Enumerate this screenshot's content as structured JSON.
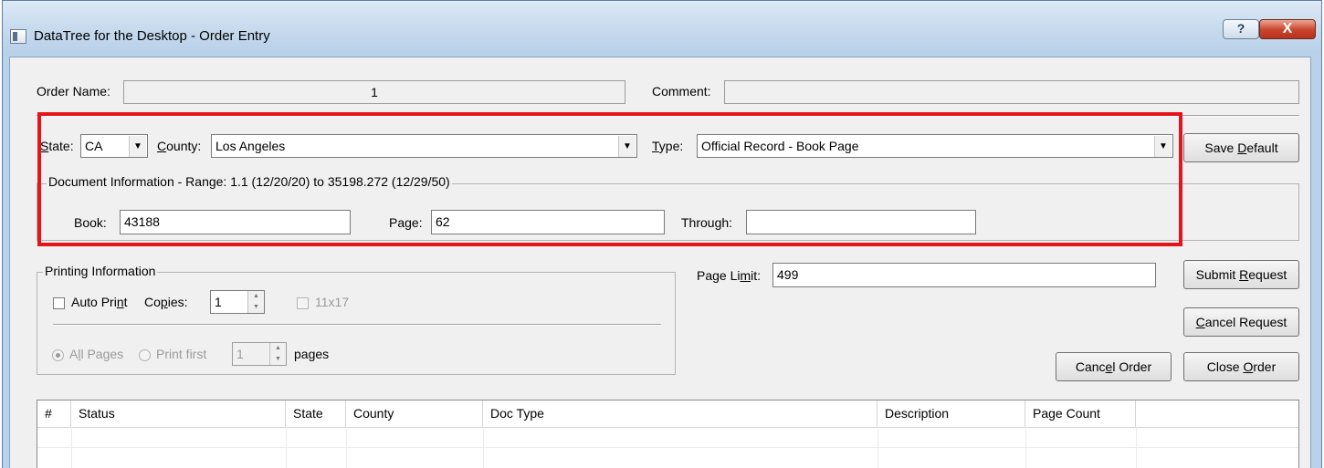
{
  "window": {
    "title": "DataTree for the Desktop - Order Entry",
    "help_label": "?",
    "close_label": "X"
  },
  "order": {
    "name_label": "Order Name:",
    "name_value": "1",
    "comment_label": "Comment:",
    "comment_value": ""
  },
  "criteria": {
    "state_label": "State:",
    "state_value": "CA",
    "county_label": "County:",
    "county_value": "Los Angeles",
    "type_label": "Type:",
    "type_value": "Official Record - Book Page",
    "save_default_label": "Save Default"
  },
  "document_info": {
    "caption": "Document Information - Range: 1.1 (12/20/20) to 35198.272 (12/29/50)",
    "book_label": "Book:",
    "book_value": "43188",
    "page_label": "Page:",
    "page_value": "62",
    "through_label": "Through:",
    "through_value": ""
  },
  "printing": {
    "caption": "Printing Information",
    "auto_print_label": "Auto Print",
    "auto_print_checked": false,
    "copies_label": "Copies:",
    "copies_value": "1",
    "size_11x17_label": "11x17",
    "all_pages_label": "All Pages",
    "print_first_label": "Print first",
    "print_first_value": "1",
    "pages_label": "pages"
  },
  "page_limit": {
    "label": "Page Limit:",
    "value": "499"
  },
  "buttons": {
    "submit_request": "Submit Request",
    "cancel_request": "Cancel Request",
    "cancel_order": "Cancel Order",
    "close_order": "Close Order"
  },
  "table": {
    "columns": [
      "#",
      "Status",
      "State",
      "County",
      "Doc Type",
      "Description",
      "Page Count"
    ],
    "rows": []
  },
  "colors": {
    "highlight_box": "#e5141a",
    "dialog_background": "#f0f0f0",
    "title_bar": "#c9dcef"
  }
}
